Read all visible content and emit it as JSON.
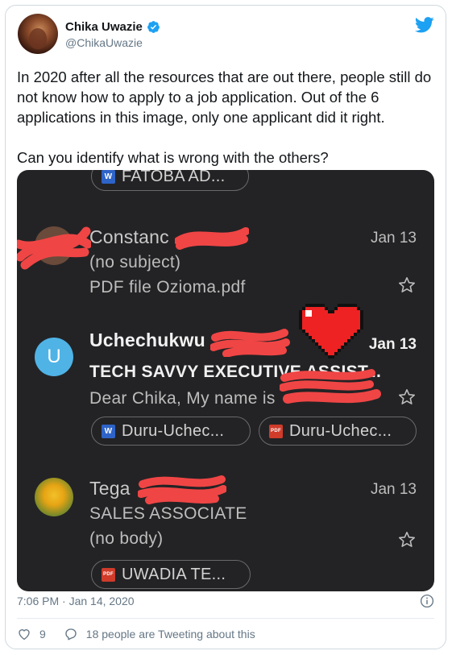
{
  "author": {
    "display_name": "Chika Uwazie",
    "handle": "@ChikaUwazie",
    "verified": true
  },
  "tweet": {
    "paragraphs": [
      "In 2020 after all the resources that are out there, people still do not know how to apply to a job application. Out of the 6 applications in this image, only one applicant did it right.",
      "Can you identify what is wrong with the others?"
    ],
    "timestamp": "7:06 PM · Jan 14, 2020",
    "like_count": "9",
    "talking_text": "18 people are Tweeting about this"
  },
  "colors": {
    "twitter_blue": "#1da1f2",
    "verified_blue": "#1da1f2",
    "screenshot_bg": "#232325",
    "redaction_red": "#f04545"
  },
  "email_screenshot": {
    "top_attachment": {
      "name": "FATOBA AD...",
      "icon": "word-doc-icon"
    },
    "emails": [
      {
        "sender": "Constanc",
        "subject": "(no subject)",
        "preview": "PDF file Ozioma.pdf",
        "date": "Jan 13",
        "unread": false,
        "avatar": "photo"
      },
      {
        "sender": "Uchechukwu",
        "subject": "TECH SAVVY EXECUTIVE ASSIST...",
        "preview": "Dear Chika, My name is",
        "date": "Jan 13",
        "unread": true,
        "avatar_letter": "U",
        "attachments": [
          {
            "name": "Duru-Uchec...",
            "icon": "word-doc-icon"
          },
          {
            "name": "Duru-Uchec...",
            "icon": "pdf-icon",
            "icon_text": "PDF"
          }
        ]
      },
      {
        "sender": "Tega",
        "subject": "SALES ASSOCIATE",
        "preview": "(no body)",
        "date": "Jan 13",
        "unread": false,
        "avatar": "flower-photo",
        "attachments": [
          {
            "name": "UWADIA TE...",
            "icon": "pdf-icon",
            "icon_text": "PDF"
          }
        ]
      }
    ],
    "overlay": "pixel-heart-icon"
  }
}
